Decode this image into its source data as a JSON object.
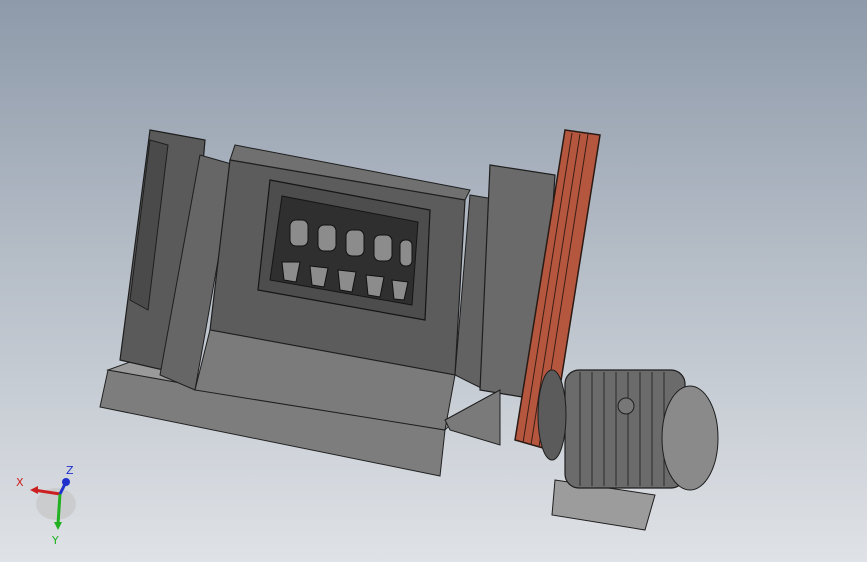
{
  "viewport": {
    "model": "crusher-with-belt-drive-motor",
    "colors": {
      "background_top": "#8e9aaa",
      "background_bottom": "#dfe2e6",
      "housing": "#5f5f5f",
      "housing_dark": "#3a3a3a",
      "housing_light": "#8a8a8a",
      "belt": "#b5563f",
      "motor": "#6b6b6b"
    }
  },
  "triad": {
    "x_label": "X",
    "y_label": "Y",
    "z_label": "Z",
    "x_color": "#cc2020",
    "y_color": "#20b020",
    "z_color": "#2030cc"
  }
}
